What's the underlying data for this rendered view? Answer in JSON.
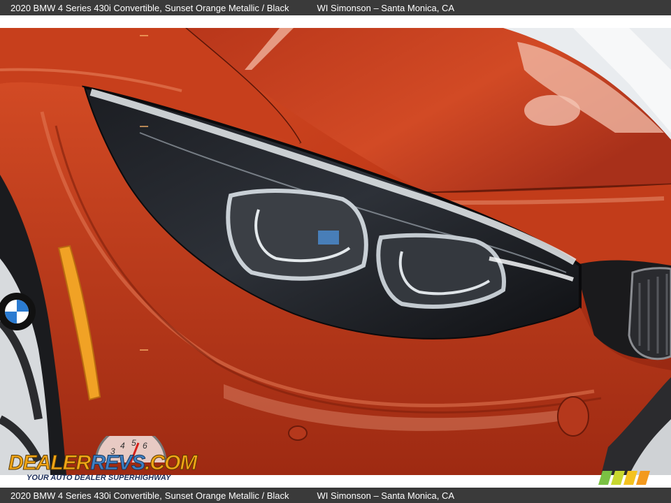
{
  "caption": {
    "vehicle": "2020 BMW 4 Series 430i Convertible,",
    "color": "Sunset Orange Metallic / Black",
    "dealer": "WI Simonson – Santa Monica, CA"
  },
  "watermark": {
    "logo_prefix": "DEALER",
    "logo_mid": "REVS",
    "logo_suffix": ".COM",
    "tagline": "YOUR AUTO DEALER SUPERHIGHWAY"
  },
  "colors": {
    "paint": "#c8411f",
    "paint_highlight": "#e8784e",
    "paint_shadow": "#7a1c0c",
    "caption_bg": "#3a3a3a"
  }
}
